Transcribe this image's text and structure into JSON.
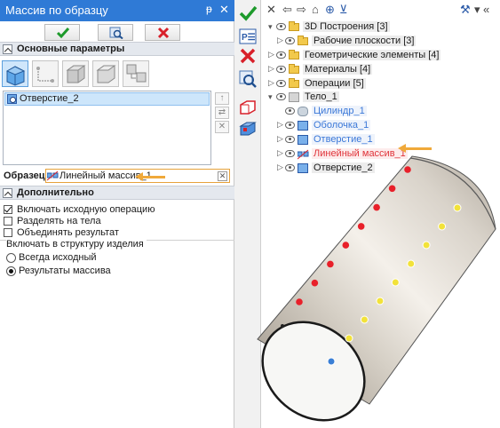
{
  "panel": {
    "title": "Массив по образцу",
    "pin_glyph": "ᵽ",
    "close_glyph": "✕",
    "sections": {
      "main": "Основные параметры",
      "additional": "Дополнительно"
    },
    "features": [
      {
        "label": "Отверстие_2",
        "icon": "hole-feature-icon"
      }
    ],
    "sample": {
      "label": "Образец:",
      "value": "Линейный массив_1"
    },
    "options": [
      {
        "label": "Включать исходную операцию",
        "checked": true
      },
      {
        "label": "Разделять на тела",
        "checked": false
      },
      {
        "label": "Объединять результат",
        "checked": false
      }
    ],
    "structure_group": {
      "label": "Включать в структуру изделия",
      "choices": [
        {
          "label": "Всегда исходный",
          "selected": false
        },
        {
          "label": "Результаты массива",
          "selected": true
        }
      ]
    }
  },
  "tree": {
    "nodes": [
      {
        "label": "3D Построения [3]",
        "icon": "folder-icon",
        "style": "normal"
      },
      {
        "label": "Рабочие плоскости [3]",
        "icon": "folder-icon",
        "style": "normal"
      },
      {
        "label": "Геометрические элементы [4]",
        "icon": "folder-icon",
        "style": "normal"
      },
      {
        "label": "Материалы [4]",
        "icon": "folder-icon",
        "style": "normal"
      },
      {
        "label": "Операции [5]",
        "icon": "folder-icon",
        "style": "normal"
      },
      {
        "label": "Тело_1",
        "icon": "body-icon",
        "style": "normal"
      },
      {
        "label": "Цилиндр_1",
        "icon": "cylinder-icon",
        "style": "blue"
      },
      {
        "label": "Оболочка_1",
        "icon": "shell-icon",
        "style": "blue"
      },
      {
        "label": "Отверстие_1",
        "icon": "hole-icon",
        "style": "blue"
      },
      {
        "label": "Линейный массив_1",
        "icon": "linear-array-icon",
        "style": "red"
      },
      {
        "label": "Отверстие_2",
        "icon": "hole-icon",
        "style": "normal"
      }
    ]
  },
  "colors": {
    "titlebar": "#2f7ad6",
    "accent_arrow": "#f0a93a",
    "hole_red": "#e8202a",
    "hole_yellow": "#f2e23a",
    "hole_blue": "#3a7fd5"
  }
}
